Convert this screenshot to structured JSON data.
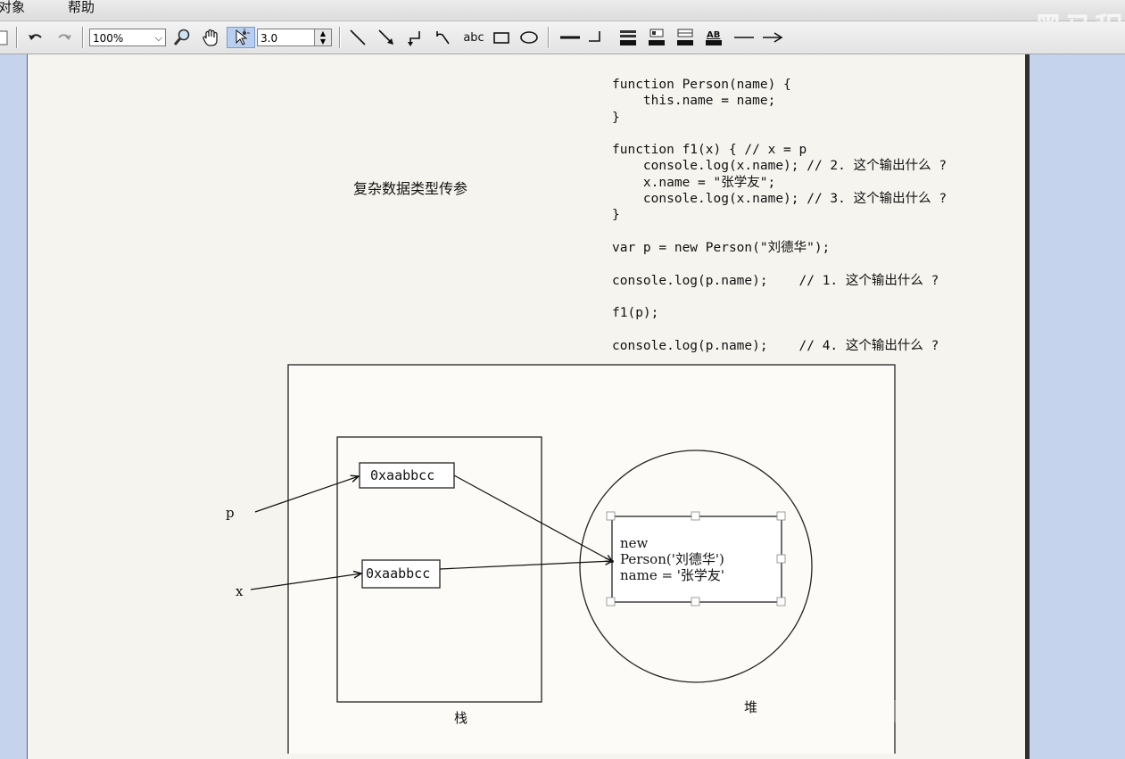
{
  "menu": {
    "items": [
      "对象",
      "帮助"
    ]
  },
  "watermark": "黑马程",
  "toolbar": {
    "zoom": "100%",
    "line_width": "3.0",
    "text_tool_label": "abc"
  },
  "canvas": {
    "title": "复杂数据类型传参",
    "code_lines": [
      "function Person(name) {",
      "    this.name = name;",
      "}",
      "",
      "function f1(x) { // x = p",
      "    console.log(x.name); // 2. 这个输出什么 ?",
      "    x.name = \"张学友\";",
      "    console.log(x.name); // 3. 这个输出什么 ?",
      "}",
      "",
      "var p = new Person(\"刘德华\");",
      "",
      "console.log(p.name);    // 1. 这个输出什么 ?",
      "",
      "f1(p);",
      "",
      "console.log(p.name);    // 4. 这个输出什么 ?"
    ],
    "diagram": {
      "var_p": "p",
      "var_x": "x",
      "addr_p": "0xaabbcc",
      "addr_x": "0xaabbcc",
      "object_line1": "new",
      "object_line2": "Person('刘德华')",
      "object_line3": "name = '张学友'",
      "stack_label": "栈",
      "heap_label": "堆"
    }
  }
}
